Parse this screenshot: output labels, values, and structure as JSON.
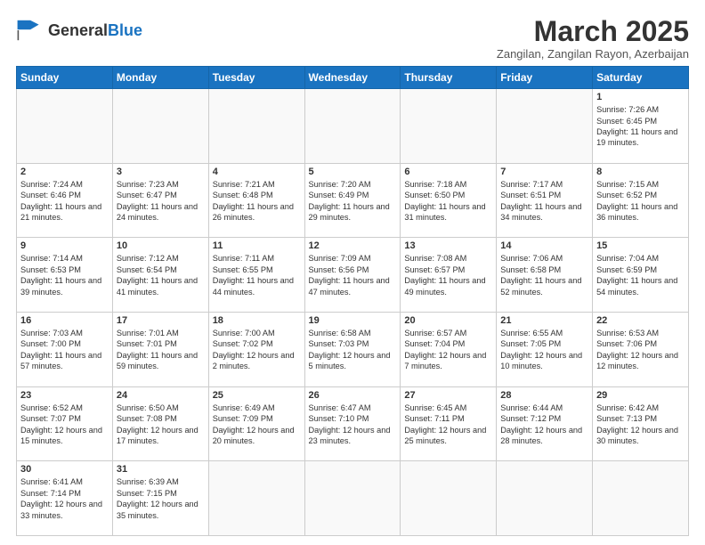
{
  "header": {
    "logo_general": "General",
    "logo_blue": "Blue",
    "month_title": "March 2025",
    "subtitle": "Zangilan, Zangilan Rayon, Azerbaijan"
  },
  "days_of_week": [
    "Sunday",
    "Monday",
    "Tuesday",
    "Wednesday",
    "Thursday",
    "Friday",
    "Saturday"
  ],
  "weeks": [
    [
      {
        "day": "",
        "info": ""
      },
      {
        "day": "",
        "info": ""
      },
      {
        "day": "",
        "info": ""
      },
      {
        "day": "",
        "info": ""
      },
      {
        "day": "",
        "info": ""
      },
      {
        "day": "",
        "info": ""
      },
      {
        "day": "1",
        "info": "Sunrise: 7:26 AM\nSunset: 6:45 PM\nDaylight: 11 hours and 19 minutes."
      }
    ],
    [
      {
        "day": "2",
        "info": "Sunrise: 7:24 AM\nSunset: 6:46 PM\nDaylight: 11 hours and 21 minutes."
      },
      {
        "day": "3",
        "info": "Sunrise: 7:23 AM\nSunset: 6:47 PM\nDaylight: 11 hours and 24 minutes."
      },
      {
        "day": "4",
        "info": "Sunrise: 7:21 AM\nSunset: 6:48 PM\nDaylight: 11 hours and 26 minutes."
      },
      {
        "day": "5",
        "info": "Sunrise: 7:20 AM\nSunset: 6:49 PM\nDaylight: 11 hours and 29 minutes."
      },
      {
        "day": "6",
        "info": "Sunrise: 7:18 AM\nSunset: 6:50 PM\nDaylight: 11 hours and 31 minutes."
      },
      {
        "day": "7",
        "info": "Sunrise: 7:17 AM\nSunset: 6:51 PM\nDaylight: 11 hours and 34 minutes."
      },
      {
        "day": "8",
        "info": "Sunrise: 7:15 AM\nSunset: 6:52 PM\nDaylight: 11 hours and 36 minutes."
      }
    ],
    [
      {
        "day": "9",
        "info": "Sunrise: 7:14 AM\nSunset: 6:53 PM\nDaylight: 11 hours and 39 minutes."
      },
      {
        "day": "10",
        "info": "Sunrise: 7:12 AM\nSunset: 6:54 PM\nDaylight: 11 hours and 41 minutes."
      },
      {
        "day": "11",
        "info": "Sunrise: 7:11 AM\nSunset: 6:55 PM\nDaylight: 11 hours and 44 minutes."
      },
      {
        "day": "12",
        "info": "Sunrise: 7:09 AM\nSunset: 6:56 PM\nDaylight: 11 hours and 47 minutes."
      },
      {
        "day": "13",
        "info": "Sunrise: 7:08 AM\nSunset: 6:57 PM\nDaylight: 11 hours and 49 minutes."
      },
      {
        "day": "14",
        "info": "Sunrise: 7:06 AM\nSunset: 6:58 PM\nDaylight: 11 hours and 52 minutes."
      },
      {
        "day": "15",
        "info": "Sunrise: 7:04 AM\nSunset: 6:59 PM\nDaylight: 11 hours and 54 minutes."
      }
    ],
    [
      {
        "day": "16",
        "info": "Sunrise: 7:03 AM\nSunset: 7:00 PM\nDaylight: 11 hours and 57 minutes."
      },
      {
        "day": "17",
        "info": "Sunrise: 7:01 AM\nSunset: 7:01 PM\nDaylight: 11 hours and 59 minutes."
      },
      {
        "day": "18",
        "info": "Sunrise: 7:00 AM\nSunset: 7:02 PM\nDaylight: 12 hours and 2 minutes."
      },
      {
        "day": "19",
        "info": "Sunrise: 6:58 AM\nSunset: 7:03 PM\nDaylight: 12 hours and 5 minutes."
      },
      {
        "day": "20",
        "info": "Sunrise: 6:57 AM\nSunset: 7:04 PM\nDaylight: 12 hours and 7 minutes."
      },
      {
        "day": "21",
        "info": "Sunrise: 6:55 AM\nSunset: 7:05 PM\nDaylight: 12 hours and 10 minutes."
      },
      {
        "day": "22",
        "info": "Sunrise: 6:53 AM\nSunset: 7:06 PM\nDaylight: 12 hours and 12 minutes."
      }
    ],
    [
      {
        "day": "23",
        "info": "Sunrise: 6:52 AM\nSunset: 7:07 PM\nDaylight: 12 hours and 15 minutes."
      },
      {
        "day": "24",
        "info": "Sunrise: 6:50 AM\nSunset: 7:08 PM\nDaylight: 12 hours and 17 minutes."
      },
      {
        "day": "25",
        "info": "Sunrise: 6:49 AM\nSunset: 7:09 PM\nDaylight: 12 hours and 20 minutes."
      },
      {
        "day": "26",
        "info": "Sunrise: 6:47 AM\nSunset: 7:10 PM\nDaylight: 12 hours and 23 minutes."
      },
      {
        "day": "27",
        "info": "Sunrise: 6:45 AM\nSunset: 7:11 PM\nDaylight: 12 hours and 25 minutes."
      },
      {
        "day": "28",
        "info": "Sunrise: 6:44 AM\nSunset: 7:12 PM\nDaylight: 12 hours and 28 minutes."
      },
      {
        "day": "29",
        "info": "Sunrise: 6:42 AM\nSunset: 7:13 PM\nDaylight: 12 hours and 30 minutes."
      }
    ],
    [
      {
        "day": "30",
        "info": "Sunrise: 6:41 AM\nSunset: 7:14 PM\nDaylight: 12 hours and 33 minutes."
      },
      {
        "day": "31",
        "info": "Sunrise: 6:39 AM\nSunset: 7:15 PM\nDaylight: 12 hours and 35 minutes."
      },
      {
        "day": "",
        "info": ""
      },
      {
        "day": "",
        "info": ""
      },
      {
        "day": "",
        "info": ""
      },
      {
        "day": "",
        "info": ""
      },
      {
        "day": "",
        "info": ""
      }
    ]
  ]
}
